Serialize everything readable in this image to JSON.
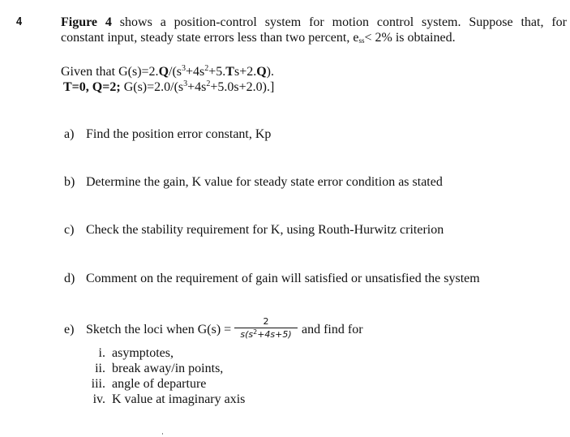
{
  "question": {
    "number": "4",
    "intro": {
      "bold_lead": "Figure 4",
      "line1_rest": " shows a position-control system for motion control system. Suppose that, for",
      "line2_a": "constant input, steady state errors less than two percent, e",
      "line2_sub": "ss",
      "line2_b": "< 2% is obtained."
    },
    "given": {
      "line1": {
        "a": "Given that G(s)=2.",
        "Q1": "Q",
        "b": "/(s",
        "exp3": "3",
        "c": "+4s",
        "exp2": "2",
        "d": "+5.",
        "T": "T",
        "e": "s+2.",
        "Q2": "Q",
        "f": ")."
      },
      "line2": {
        "lead": "T=0, Q=2;",
        "a": " G(s)=2.0/(s",
        "exp3": "3",
        "b": "+4s",
        "exp2": "2",
        "c": "+5.0s+2.0).]"
      }
    },
    "parts": [
      {
        "label": "a)",
        "text": "Find the position error constant, Kp"
      },
      {
        "label": "b)",
        "text": "Determine the gain, K value for steady state error condition as stated"
      },
      {
        "label": "c)",
        "text": "Check the stability requirement for K, using Routh-Hurwitz criterion"
      },
      {
        "label": "d)",
        "text": "Comment on the requirement of gain will satisfied or unsatisfied the system"
      },
      {
        "label": "e)",
        "text_before": "Sketch the loci when G(s) =",
        "fraction": {
          "numerator": "2",
          "den_a": "s(s",
          "den_exp": "2",
          "den_b": "+4s+5)"
        },
        "text_after": "and find for",
        "sub_items": [
          {
            "numeral": "i.",
            "text": "asymptotes,"
          },
          {
            "numeral": "ii.",
            "text": "break away/in points,"
          },
          {
            "numeral": "iii.",
            "text": "angle of departure"
          },
          {
            "numeral": "iv.",
            "text": "K value at imaginary axis"
          }
        ]
      }
    ]
  }
}
